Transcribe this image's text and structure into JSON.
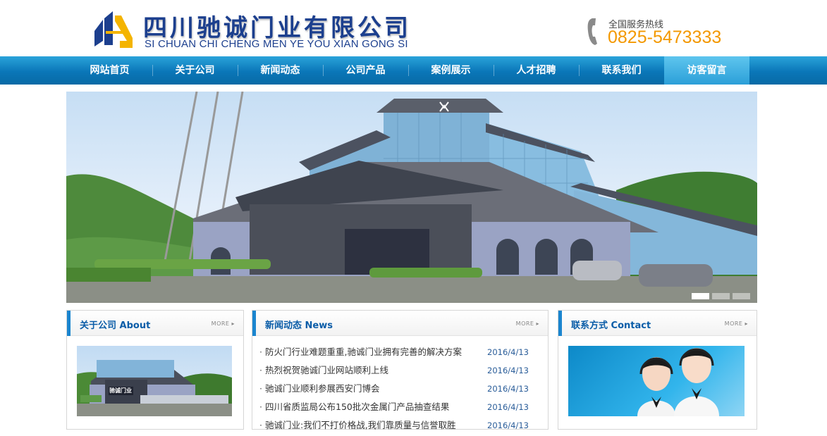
{
  "header": {
    "company_cn": "四川驰诚门业有限公司",
    "company_en": "SI CHUAN CHI CHENG MEN YE YOU XIAN GONG SI",
    "hotline_label": "全国服务热线",
    "hotline_number": "0825-5473333"
  },
  "nav": {
    "items": [
      {
        "label": "网站首页"
      },
      {
        "label": "关于公司"
      },
      {
        "label": "新闻动态"
      },
      {
        "label": "公司产品"
      },
      {
        "label": "案例展示"
      },
      {
        "label": "人才招聘"
      },
      {
        "label": "联系我们"
      },
      {
        "label": "访客留言",
        "active": true
      }
    ]
  },
  "banner": {
    "slide_count": 3,
    "active_slide": 1
  },
  "about": {
    "title": "关于公司 About",
    "more": "MORE",
    "image_sign": "驰诚门业"
  },
  "news": {
    "title": "新闻动态 News",
    "more": "MORE",
    "bullet": "·",
    "items": [
      {
        "title": "防火门行业难题重重,驰诚门业拥有完善的解决方案",
        "date": "2016/4/13"
      },
      {
        "title": "热烈祝贺驰诚门业网站顺利上线",
        "date": "2016/4/13"
      },
      {
        "title": "驰诚门业顺利参展西安门博会",
        "date": "2016/4/13"
      },
      {
        "title": "四川省质监局公布150批次金属门产品抽查结果",
        "date": "2016/4/13"
      },
      {
        "title": "驰诚门业:我们不打价格战,我们靠质量与信誉取胜",
        "date": "2016/4/13"
      }
    ]
  },
  "contact": {
    "title": "联系方式 Contact",
    "more": "MORE"
  },
  "colors": {
    "brand_blue": "#1c3f8e",
    "nav_blue": "#0a76b8",
    "hotline_orange": "#f39800",
    "accent_bar": "#1a85cf"
  }
}
